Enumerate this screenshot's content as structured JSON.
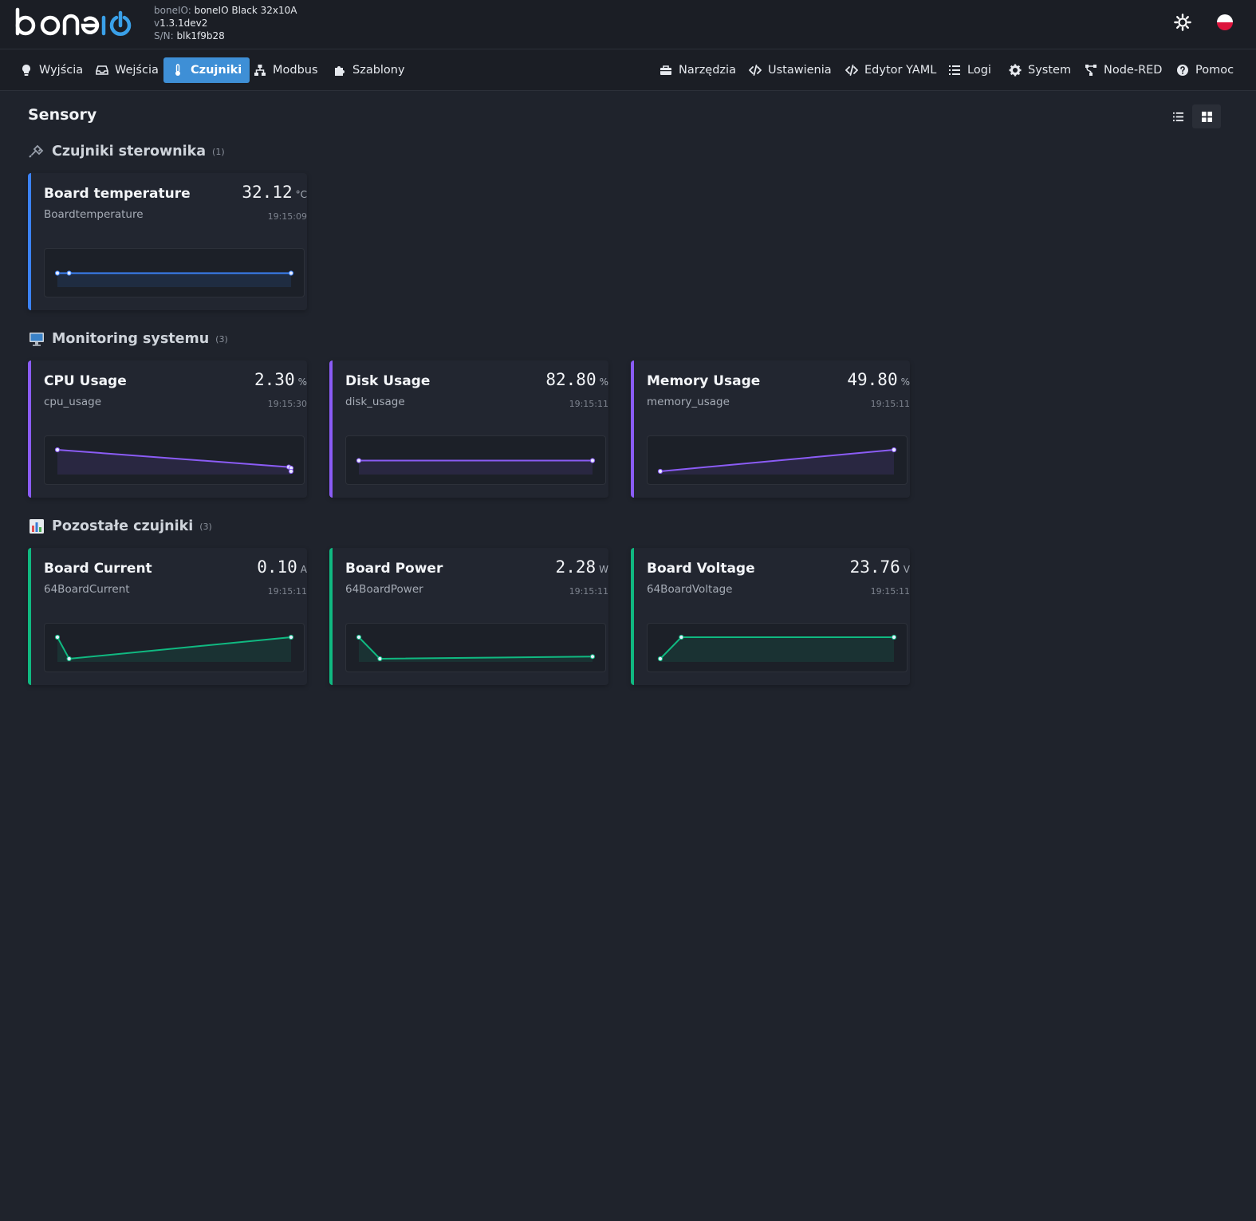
{
  "header": {
    "device_key": "boneIO:",
    "device_name": "boneIO Black 32x10A",
    "version_key": "v",
    "version": "1.3.1dev2",
    "sn_key": "S/N:",
    "serial": "blk1f9b28"
  },
  "nav": {
    "left": [
      {
        "label": "Wyjścia",
        "icon": "lightbulb-icon"
      },
      {
        "label": "Wejścia",
        "icon": "inbox-icon"
      },
      {
        "label": "Czujniki",
        "icon": "thermometer-icon",
        "active": true
      },
      {
        "label": "Modbus",
        "icon": "network-icon"
      },
      {
        "label": "Szablony",
        "icon": "puzzle-icon"
      }
    ],
    "right": [
      {
        "label": "Narzędzia",
        "icon": "toolbox-icon"
      },
      {
        "label": "Ustawienia",
        "icon": "code-icon"
      },
      {
        "label": "Edytor YAML",
        "icon": "code-icon"
      },
      {
        "label": "Logi",
        "icon": "list-icon"
      },
      {
        "label": "System",
        "icon": "gear-icon"
      },
      {
        "label": "Node-RED",
        "icon": "node-icon"
      },
      {
        "label": "Pomoc",
        "icon": "help-icon"
      }
    ]
  },
  "page": {
    "title": "Sensory"
  },
  "colors": {
    "controller": "#3b82f6",
    "system": "#8b5cf6",
    "other": "#10b981",
    "active_nav": "#3e8fd6"
  },
  "sections": [
    {
      "title": "Czujniki sterownika",
      "count": "(1)",
      "icon": "plug-icon",
      "accent": "controller",
      "cards": [
        {
          "name": "Board temperature",
          "id": "Boardtemperature",
          "value": "32.12",
          "unit": "°C",
          "time": "19:15:09",
          "points": [
            0.5,
            0.5,
            0.5
          ],
          "x": [
            0,
            0.05,
            1
          ]
        }
      ]
    },
    {
      "title": "Monitoring systemu",
      "count": "(3)",
      "icon": "monitor-icon",
      "accent": "system",
      "cards": [
        {
          "name": "CPU Usage",
          "id": "cpu_usage",
          "value": "2.30",
          "unit": "%",
          "time": "19:15:30",
          "points": [
            1,
            0.2,
            0.15,
            0
          ],
          "x": [
            0,
            0.99,
            1,
            1
          ]
        },
        {
          "name": "Disk Usage",
          "id": "disk_usage",
          "value": "82.80",
          "unit": "%",
          "time": "19:15:11",
          "points": [
            0.5,
            0.5
          ],
          "x": [
            0,
            1
          ]
        },
        {
          "name": "Memory Usage",
          "id": "memory_usage",
          "value": "49.80",
          "unit": "%",
          "time": "19:15:11",
          "points": [
            0,
            1
          ],
          "x": [
            0,
            1
          ]
        }
      ]
    },
    {
      "title": "Pozostałe czujniki",
      "count": "(3)",
      "icon": "bar-chart-icon",
      "accent": "other",
      "cards": [
        {
          "name": "Board Current",
          "id": "64BoardCurrent",
          "value": "0.10",
          "unit": "A",
          "time": "19:15:11",
          "points": [
            1,
            0,
            1
          ],
          "x": [
            0,
            0.05,
            1
          ]
        },
        {
          "name": "Board Power",
          "id": "64BoardPower",
          "value": "2.28",
          "unit": "W",
          "time": "19:15:11",
          "points": [
            1,
            0,
            0.1
          ],
          "x": [
            0,
            0.09,
            1
          ]
        },
        {
          "name": "Board Voltage",
          "id": "64BoardVoltage",
          "value": "23.76",
          "unit": "V",
          "time": "19:15:11",
          "points": [
            0,
            1,
            1
          ],
          "x": [
            0,
            0.09,
            1
          ]
        }
      ]
    }
  ]
}
